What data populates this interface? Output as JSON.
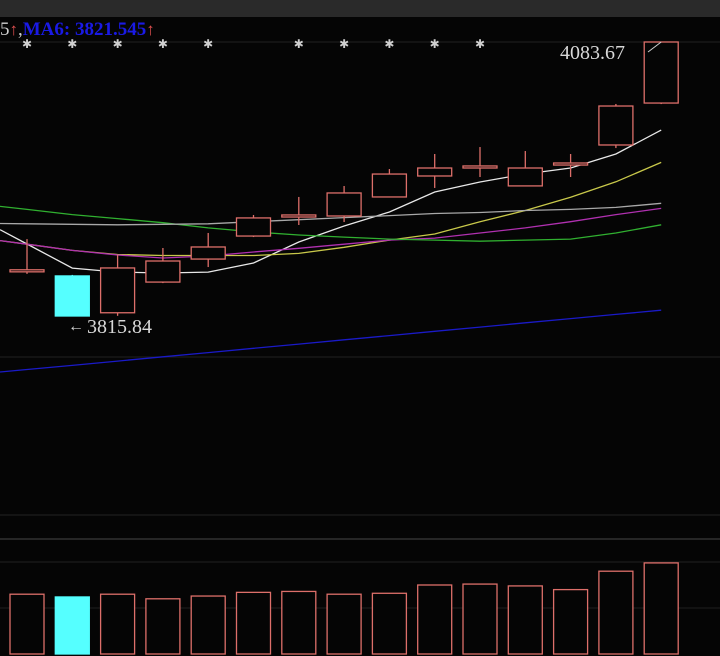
{
  "header": {
    "prev_fragment": "5",
    "ma6_label": "MA6:",
    "ma6_value": "3821.545",
    "arrow_glyph": "↑"
  },
  "annotations": {
    "high_label": "4083.67",
    "low_label": "3815.84",
    "low_arrow": "←"
  },
  "colors": {
    "up": "#dd6f6a",
    "down": "#55ffff",
    "ma_white": "#e8e8e8",
    "ma_yellow": "#c8c84a",
    "ma_magenta": "#b030b0",
    "ma_green": "#30b030",
    "ma_gray": "#a8a8a8",
    "ma6_blue": "#1a1ac8"
  },
  "chart_data": [
    {
      "type": "candlestick",
      "title": "",
      "ylim": [
        3815.84,
        4083.67
      ],
      "grid": true,
      "candles": [
        {
          "o": 3859,
          "h": 3891,
          "l": 3857,
          "c": 3861
        },
        {
          "o": 3855,
          "h": 3856,
          "l": 3815.84,
          "c": 3815.84
        },
        {
          "o": 3819,
          "h": 3875.5,
          "l": 3816,
          "c": 3862.8
        },
        {
          "o": 3849,
          "h": 3882.3,
          "l": 3848,
          "c": 3869.6
        },
        {
          "o": 3871.5,
          "h": 3897,
          "l": 3863.7,
          "c": 3883.3
        },
        {
          "o": 3894,
          "h": 3914.6,
          "l": 3893,
          "c": 3911.7
        },
        {
          "o": 3912.6,
          "h": 3932.2,
          "l": 3904.8,
          "c": 3914.6
        },
        {
          "o": 3913.6,
          "h": 3942.9,
          "l": 3907.7,
          "c": 3936.1
        },
        {
          "o": 3932.2,
          "h": 3959.5,
          "l": 3932,
          "c": 3954.6
        },
        {
          "o": 3952.7,
          "h": 3974.2,
          "l": 3941,
          "c": 3960.5
        },
        {
          "o": 3960.5,
          "h": 3981,
          "l": 3951.7,
          "c": 3962.5
        },
        {
          "o": 3943,
          "h": 3977.1,
          "l": 3943,
          "c": 3960.5
        },
        {
          "o": 3963.4,
          "h": 3974.2,
          "l": 3951.7,
          "c": 3965.4
        },
        {
          "o": 3983,
          "h": 4023.1,
          "l": 3980,
          "c": 4021.1
        },
        {
          "o": 4024,
          "h": 4083.67,
          "l": 4023,
          "c": 4083.67
        }
      ],
      "markers_on": [
        0,
        1,
        2,
        3,
        4,
        6,
        7,
        8,
        9,
        10
      ],
      "ma_series": [
        {
          "name": "ma_white",
          "values": [
            3886.2,
            3862.7,
            3858.8,
            3857.9,
            3858.8,
            3867.6,
            3888.2,
            3903.8,
            3917.5,
            3937.0,
            3946.8,
            3954.6,
            3960.5,
            3974.2,
            3997.6
          ]
        },
        {
          "name": "ma_yellow",
          "values": [
            3886,
            3880,
            3876,
            3875,
            3875,
            3875,
            3877,
            3883,
            3890,
            3896,
            3908,
            3919,
            3932,
            3947,
            3966
          ]
        },
        {
          "name": "ma_magenta",
          "values": [
            3886,
            3880,
            3875.5,
            3872.5,
            3874.5,
            3878.4,
            3882,
            3886,
            3890,
            3892,
            3897,
            3902,
            3908,
            3915,
            3921
          ]
        },
        {
          "name": "ma_green",
          "values": [
            3920,
            3915,
            3911,
            3907,
            3902,
            3898,
            3895,
            3893,
            3891,
            3890,
            3889,
            3890,
            3891,
            3897,
            3905
          ]
        },
        {
          "name": "ma_gray",
          "values": [
            3906,
            3905.5,
            3905,
            3905.5,
            3906,
            3908,
            3910,
            3912,
            3914,
            3916,
            3917,
            3919,
            3920,
            3922,
            3926
          ]
        },
        {
          "name": "ma6_blue",
          "values": [
            3763.5,
            3767.6,
            3771.8,
            3776.0,
            3780.1,
            3784.3,
            3788.4,
            3792.6,
            3796.7,
            3800.9,
            3805.0,
            3809.2,
            3813.3,
            3817.4,
            3821.545
          ]
        }
      ]
    },
    {
      "type": "bar",
      "title": "volume",
      "ylim": [
        0,
        100
      ],
      "values": [
        65,
        62,
        65,
        60,
        63,
        67,
        68,
        65,
        66,
        75,
        76,
        74,
        70,
        90,
        99
      ]
    }
  ]
}
